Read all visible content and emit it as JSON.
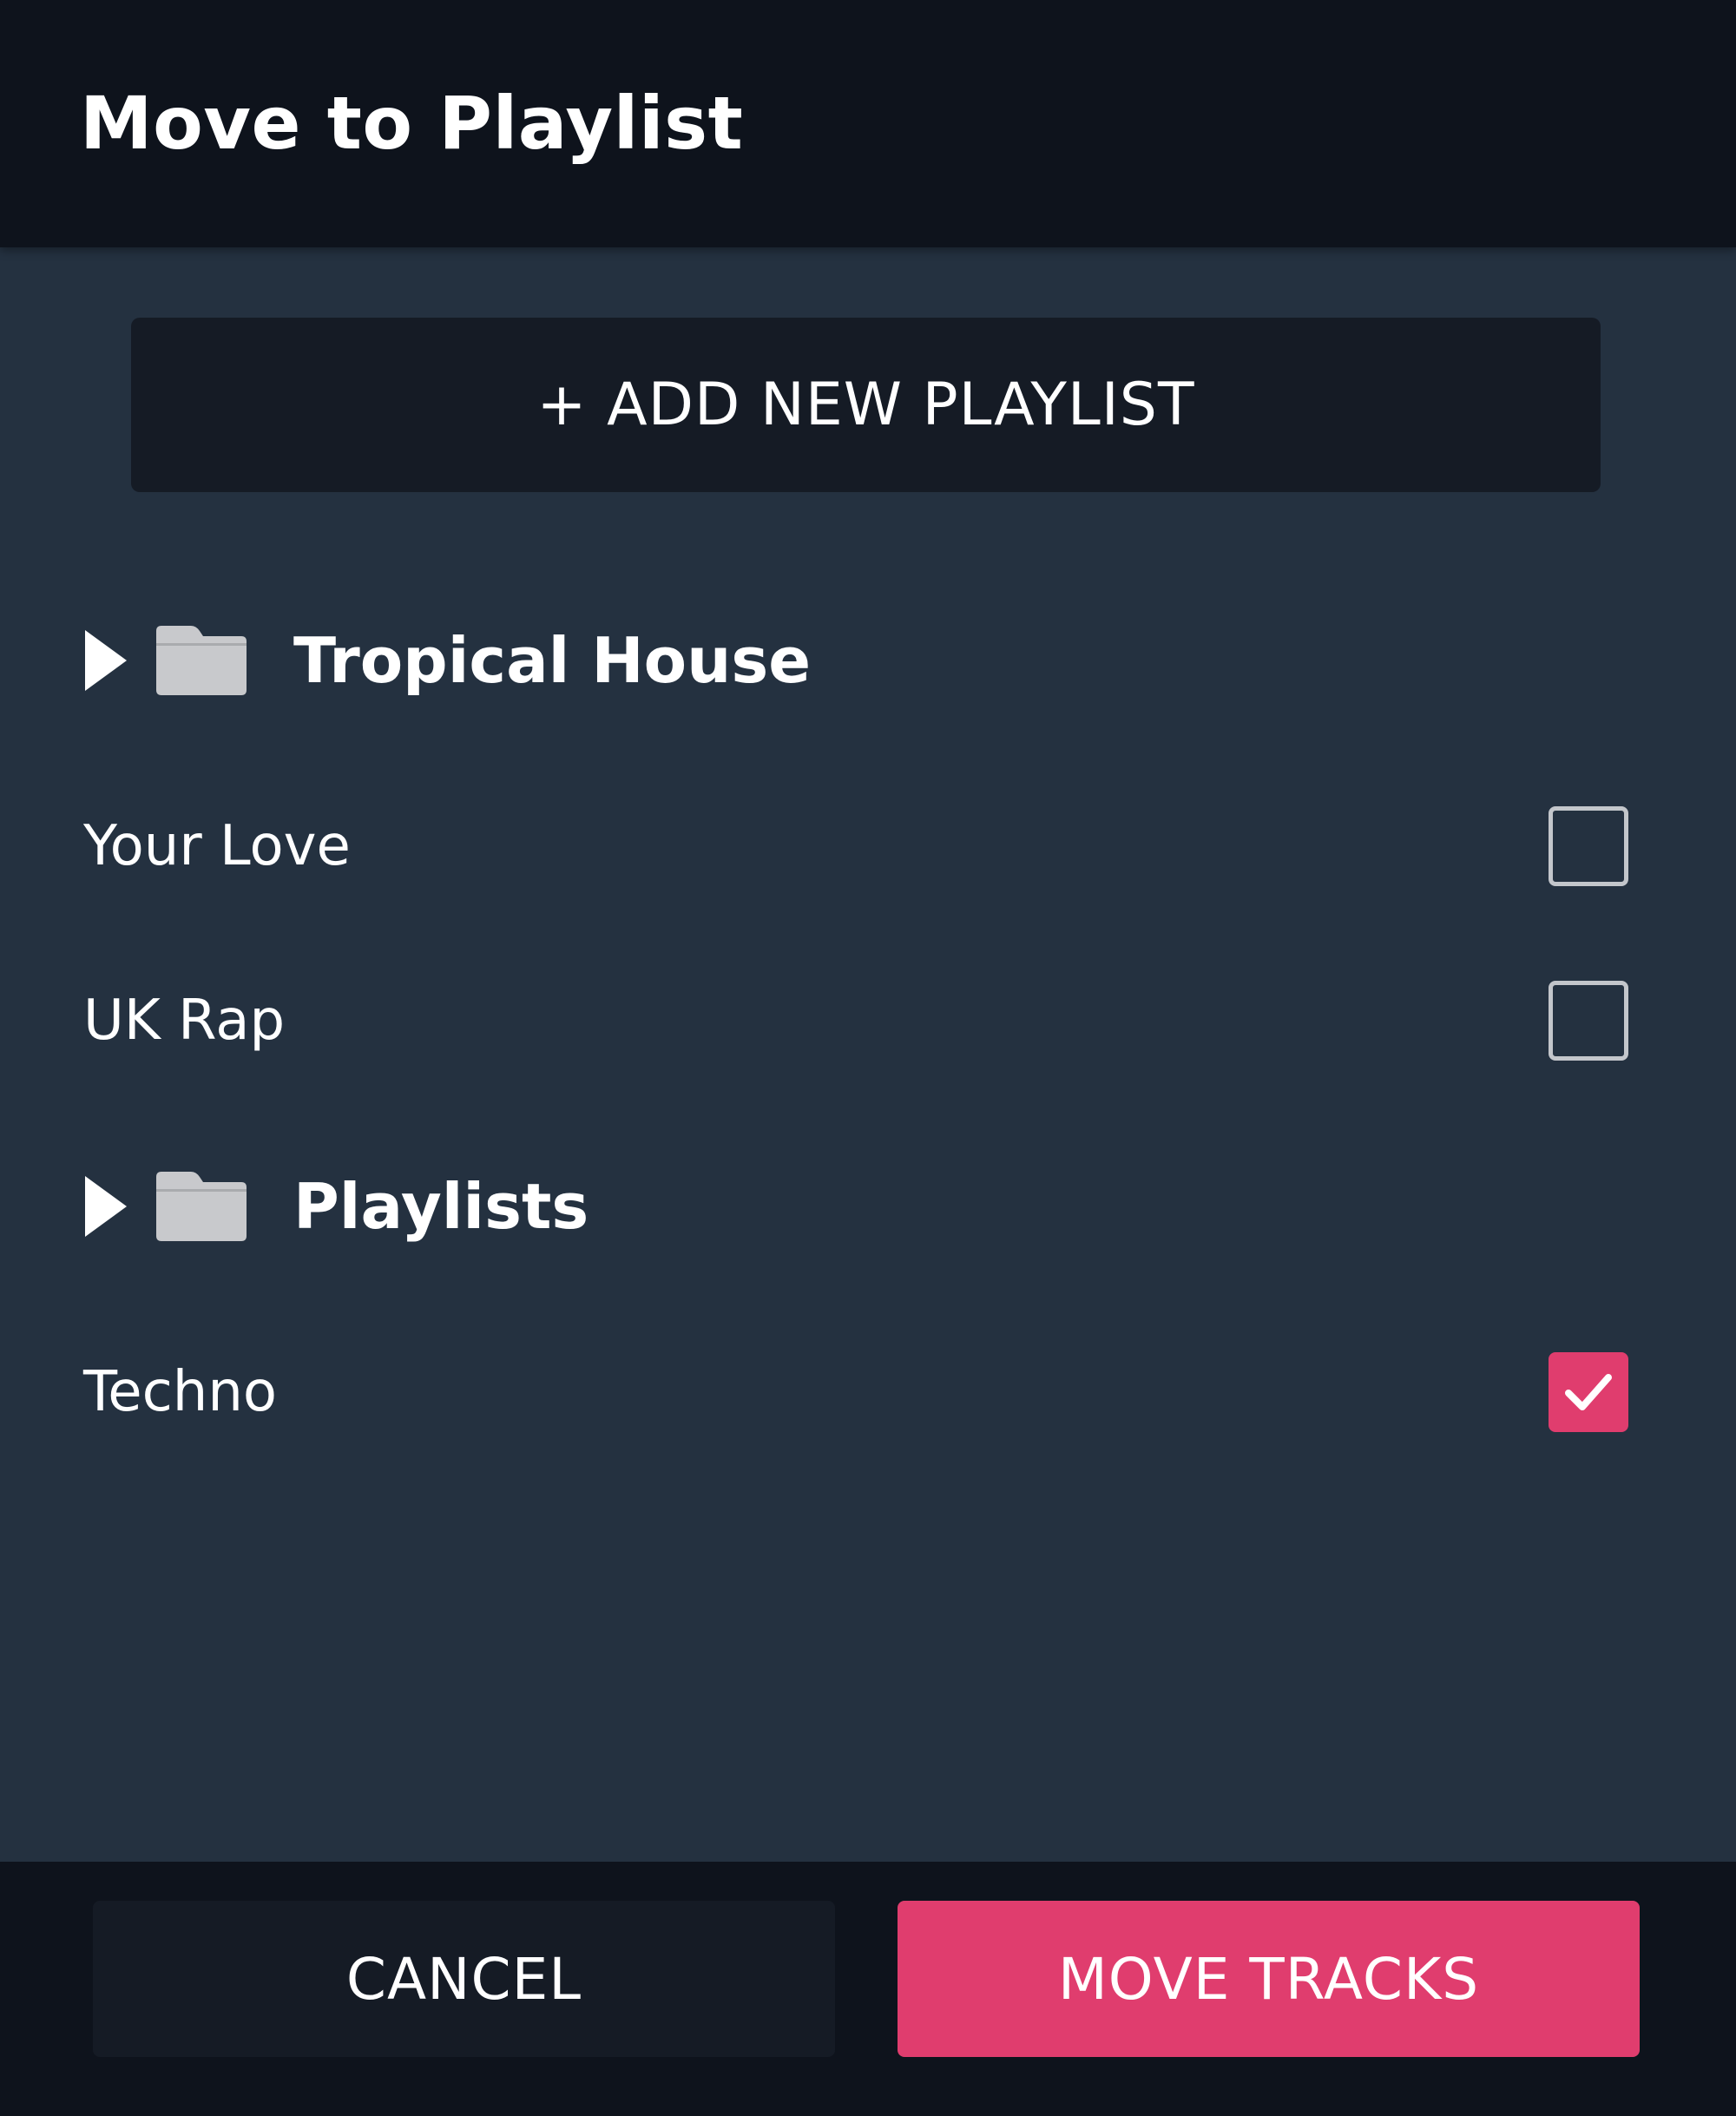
{
  "dialog": {
    "title": "Move to Playlist",
    "add_button_label": "+ ADD NEW PLAYLIST"
  },
  "folders": [
    {
      "label": "Tropical House",
      "expanded": false
    },
    {
      "label": "Playlists",
      "expanded": false
    }
  ],
  "playlists": [
    {
      "label": "Your Love",
      "checked": false
    },
    {
      "label": "UK Rap",
      "checked": false
    },
    {
      "label": "Techno",
      "checked": true
    }
  ],
  "footer": {
    "cancel_label": "CANCEL",
    "move_label": "MOVE TRACKS"
  },
  "colors": {
    "accent": "#e03d6e",
    "background": "#243140",
    "header": "#0e131c",
    "button_dark": "#151b25"
  },
  "icons": {
    "caret": "caret-right-icon",
    "folder": "folder-icon",
    "check": "check-icon"
  }
}
